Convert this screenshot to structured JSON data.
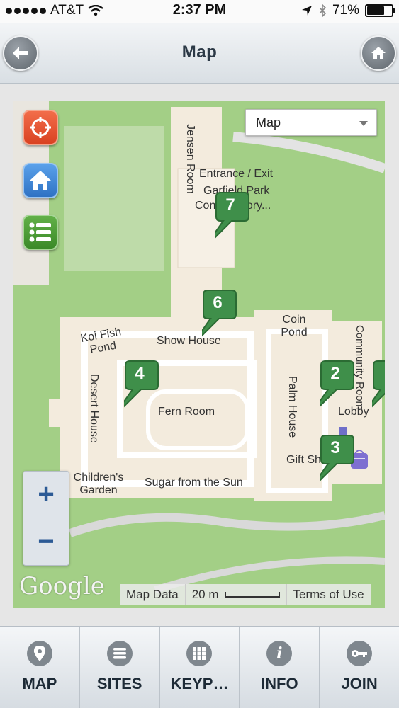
{
  "status_bar": {
    "carrier": "AT&T",
    "time": "2:37 PM",
    "battery": "71%",
    "battery_level": 0.71
  },
  "header": {
    "title": "Map",
    "back_icon": "arrow-left-icon",
    "home_icon": "home-icon"
  },
  "map": {
    "map_type": "Map",
    "labels": {
      "jensen_room": "Jensen Room",
      "entrance_exit": "Entrance / Exit",
      "garfield_park": "Garfield Park",
      "conservatory": "Conservatory...",
      "coin_pond": "Coin Pond",
      "community_room": "Community Room",
      "koi_fish_pond": "Koi Fish Pond",
      "show_house": "Show House",
      "desert_house": "Desert House",
      "fern_room": "Fern Room",
      "palm_house": "Palm House",
      "lobby": "Lobby",
      "gift_shop": "Gift Sh",
      "childrens_garden": "Children's Garden",
      "sugar_from_the_sun": "Sugar from the Sun"
    },
    "markers": [
      "7",
      "6",
      "4",
      "2",
      "3"
    ],
    "zoom_in": "+",
    "zoom_out": "−",
    "google": "Google",
    "map_data": "Map Data",
    "scale": "20 m",
    "terms": "Terms of Use"
  },
  "tabs": [
    {
      "label": "MAP",
      "icon": "map-pin-icon"
    },
    {
      "label": "SITES",
      "icon": "list-icon"
    },
    {
      "label": "KEYP…",
      "icon": "keypad-icon"
    },
    {
      "label": "INFO",
      "icon": "info-icon"
    },
    {
      "label": "JOIN",
      "icon": "key-icon"
    }
  ]
}
